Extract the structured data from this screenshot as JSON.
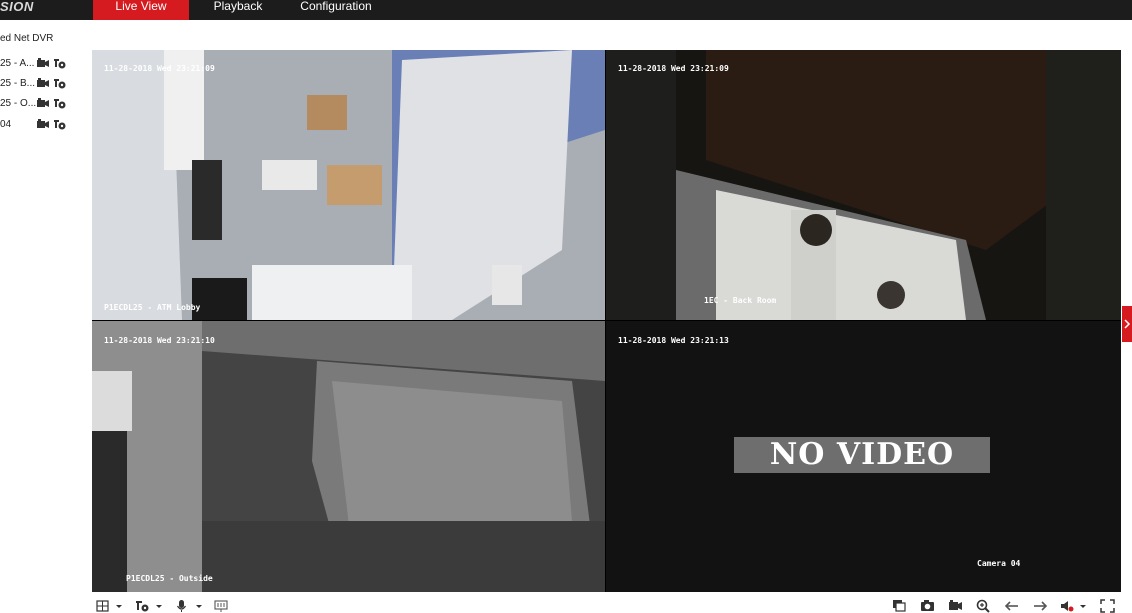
{
  "header": {
    "logo_text": "SION",
    "tabs": [
      {
        "label": "Live View",
        "active": true
      },
      {
        "label": "Playback",
        "active": false
      },
      {
        "label": "Configuration",
        "active": false
      }
    ]
  },
  "sidebar": {
    "device_name": "ed Net DVR",
    "cameras": [
      {
        "label": "25 - A..."
      },
      {
        "label": "25 - B..."
      },
      {
        "label": "25 - O..."
      },
      {
        "label": "04"
      }
    ]
  },
  "video": {
    "tiles": [
      {
        "timestamp": "11-28-2018 Wed 23:21:09",
        "channel_name": "P1ECDL25 - ATM Lobby",
        "selected": true
      },
      {
        "timestamp": "11-28-2018 Wed 23:21:09",
        "channel_name": "1EC - Back Room",
        "selected": false
      },
      {
        "timestamp": "11-28-2018 Wed 23:21:10",
        "channel_name": "P1ECDL25 - Outside",
        "selected": false
      },
      {
        "timestamp": "11-28-2018 Wed 23:21:13",
        "channel_name": "Camera 04",
        "no_video_text": "NO VIDEO",
        "selected": false
      }
    ]
  },
  "toolbar": {
    "left_icons": [
      "layout-grid-icon",
      "stream-type-icon",
      "microphone-icon",
      "all-start-icon"
    ],
    "right_icons": [
      "stop-all-icon",
      "capture-icon",
      "record-icon",
      "digital-zoom-icon",
      "prev-page-icon",
      "next-page-icon",
      "volume-icon",
      "fullscreen-icon"
    ]
  },
  "colors": {
    "accent": "#d51b20",
    "topbar": "#1c1c1c",
    "selected_border": "#d9a520"
  }
}
